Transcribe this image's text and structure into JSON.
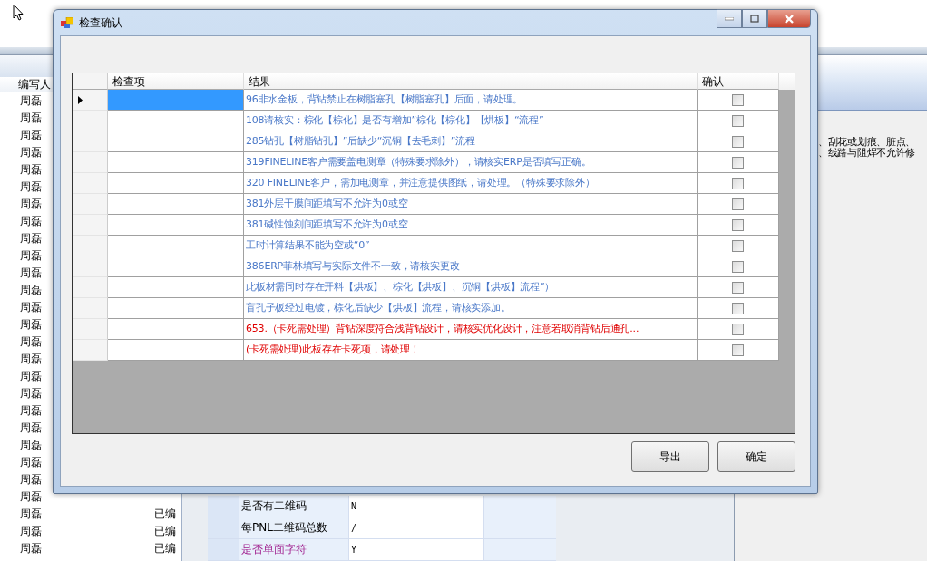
{
  "background_app": {
    "list_header": "编写人",
    "list_rows": [
      {
        "writer": "周磊"
      },
      {
        "writer": "周磊"
      },
      {
        "writer": "周磊"
      },
      {
        "writer": "周磊"
      },
      {
        "writer": "周磊"
      },
      {
        "writer": "周磊"
      },
      {
        "writer": "周磊"
      },
      {
        "writer": "周磊"
      },
      {
        "writer": "周磊"
      },
      {
        "writer": "周磊"
      },
      {
        "writer": "周磊"
      },
      {
        "writer": "周磊"
      },
      {
        "writer": "周磊"
      },
      {
        "writer": "周磊"
      },
      {
        "writer": "周磊"
      },
      {
        "writer": "周磊"
      },
      {
        "writer": "周磊"
      },
      {
        "writer": "周磊"
      },
      {
        "writer": "周磊"
      },
      {
        "writer": "周磊"
      },
      {
        "writer": "周磊"
      },
      {
        "writer": "周磊"
      },
      {
        "writer": "周磊"
      },
      {
        "writer": "周磊"
      },
      {
        "writer": "周磊",
        "status": "已编"
      },
      {
        "writer": "周磊",
        "status": "已编"
      },
      {
        "writer": "周磊",
        "status": "已编"
      }
    ],
    "detail_rows": [
      {
        "label": "是否有二维码",
        "value": "N",
        "emphasis": false
      },
      {
        "label": "每PNL二维码总数",
        "value": "/",
        "emphasis": false
      },
      {
        "label": "是否单面字符",
        "value": "Y",
        "emphasis": true
      }
    ],
    "notes": [
      "、刮花或划痕、脏点、",
      "、线路与阻焊不允许修"
    ]
  },
  "dialog": {
    "title": "检查确认",
    "columns": [
      "检查项",
      "结果",
      "确认"
    ],
    "rows": [
      {
        "result": "96非水金板，背钻禁止在树脂塞孔【树脂塞孔】后面，请处理。",
        "kind": "normal",
        "confirmed": false,
        "selected": true
      },
      {
        "result": "108请核实：棕化【棕化】是否有增加”棕化【棕化】【烘板】“流程”",
        "kind": "normal",
        "confirmed": false,
        "selected": false
      },
      {
        "result": "285钻孔【树脂钻孔】”后缺少“沉铜【去毛刺】”流程",
        "kind": "normal",
        "confirmed": false,
        "selected": false
      },
      {
        "result": "319FINELINE客户需要盖电测章（特殊要求除外），请核实ERP是否填写正确。",
        "kind": "normal",
        "confirmed": false,
        "selected": false
      },
      {
        "result": "320 FINELINE客户，需加电测章，并注意提供图纸，请处理。（特殊要求除外）",
        "kind": "normal",
        "confirmed": false,
        "selected": false
      },
      {
        "result": "381外层干膜间距填写不允许为0或空",
        "kind": "normal",
        "confirmed": false,
        "selected": false
      },
      {
        "result": "381碱性蚀刻间距填写不允许为0或空",
        "kind": "normal",
        "confirmed": false,
        "selected": false
      },
      {
        "result": "工时计算结果不能为空或“0”",
        "kind": "normal",
        "confirmed": false,
        "selected": false
      },
      {
        "result": "386ERP菲林填写与实际文件不一致，请核实更改",
        "kind": "normal",
        "confirmed": false,
        "selected": false
      },
      {
        "result": "此板材需同时存在开料【烘板】、棕化【烘板】、沉铜【烘板】流程”）",
        "kind": "normal",
        "confirmed": false,
        "selected": false
      },
      {
        "result": "盲孔子板经过电镀，棕化后缺少【烘板】流程，请核实添加。",
        "kind": "normal",
        "confirmed": false,
        "selected": false
      },
      {
        "result": "653.（卡死需处理）背钻深度符合浅背钻设计，请核实优化设计，注意若取消背钻后通孔...",
        "kind": "critical",
        "confirmed": false,
        "selected": false
      },
      {
        "result": "(卡死需处理)此板存在卡死项，请处理！",
        "kind": "critical",
        "confirmed": false,
        "selected": false
      }
    ],
    "buttons": [
      "导出",
      "确定"
    ]
  }
}
